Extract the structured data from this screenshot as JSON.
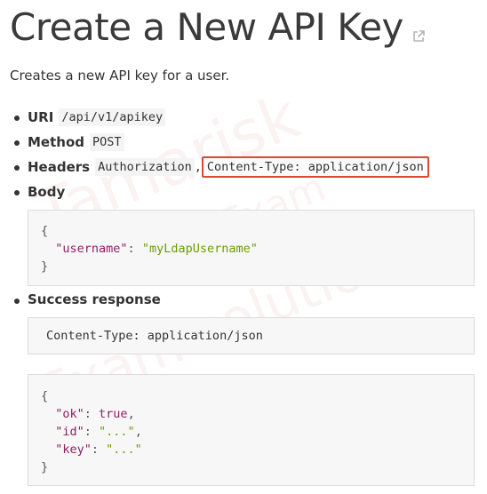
{
  "title": "Create a New API Key",
  "intro": "Creates a new API key for a user.",
  "fields": {
    "uri": {
      "label": "URI",
      "value": "/api/v1/apikey"
    },
    "method": {
      "label": "Method",
      "value": "POST"
    },
    "headers": {
      "label": "Headers",
      "value1": "Authorization",
      "separator": ",",
      "value2": "Content-Type: application/json"
    },
    "body": {
      "label": "Body"
    }
  },
  "body_code": {
    "open": "{",
    "key": "\"username\"",
    "colon": ": ",
    "value": "\"myLdapUsername\"",
    "close": "}"
  },
  "success": {
    "label": "Success response",
    "header_line": "Content-Type: application/json",
    "open": "{",
    "ok_key": "\"ok\"",
    "ok_val": "true",
    "id_key": "\"id\"",
    "id_val": "\"...\"",
    "key_key": "\"key\"",
    "key_val": "\"...\"",
    "close": "}"
  },
  "watermark": {
    "line1": "Tamarisk",
    "line2": "OffsecExam",
    "line3": "Exam solution"
  },
  "colors": {
    "highlight_border": "#d84b32",
    "json_key": "#8e1f63",
    "json_string": "#6b9e06"
  },
  "icons": {
    "title_link": "external-link-icon"
  }
}
